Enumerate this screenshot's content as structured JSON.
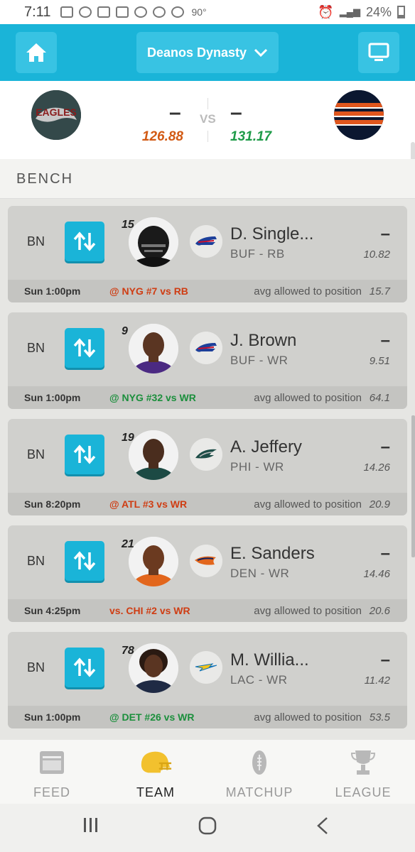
{
  "status": {
    "time": "7:11",
    "temperature": "90°",
    "network": "4G LTE",
    "battery": "24%"
  },
  "header": {
    "league_name": "Deanos Dynasty",
    "home_icon": "home-icon",
    "tv_icon": "monitor-icon",
    "dropdown_icon": "chevron-down-icon"
  },
  "matchup": {
    "home_team_logo": "Philadelphia Eagles logo",
    "away_team_logo": "Chicago striped logo",
    "home_dash": "–",
    "away_dash": "–",
    "vs": "VS",
    "home_score": "126.88",
    "away_score": "131.17"
  },
  "section_title": "BENCH",
  "players": [
    {
      "slot": "BN",
      "number": "15",
      "name": "D. Single...",
      "team_pos": "BUF - RB",
      "projected": "–",
      "points": "10.82",
      "time": "Sun 1:00pm",
      "opponent": "@ NYG #7 vs RB",
      "opponent_color": "red",
      "avg_label": "avg allowed to position",
      "avg_value": "15.7",
      "team_logo": "bills"
    },
    {
      "slot": "BN",
      "number": "9",
      "name": "J. Brown",
      "team_pos": "BUF - WR",
      "projected": "–",
      "points": "9.51",
      "time": "Sun 1:00pm",
      "opponent": "@ NYG #32 vs WR",
      "opponent_color": "green",
      "avg_label": "avg allowed to position",
      "avg_value": "64.1",
      "team_logo": "bills"
    },
    {
      "slot": "BN",
      "number": "19",
      "name": "A. Jeffery",
      "team_pos": "PHI - WR",
      "projected": "–",
      "points": "14.26",
      "time": "Sun 8:20pm",
      "opponent": "@ ATL #3 vs WR",
      "opponent_color": "red",
      "avg_label": "avg allowed to position",
      "avg_value": "20.9",
      "team_logo": "eagles"
    },
    {
      "slot": "BN",
      "number": "21",
      "name": "E. Sanders",
      "team_pos": "DEN - WR",
      "projected": "–",
      "points": "14.46",
      "time": "Sun 4:25pm",
      "opponent": "vs. CHI #2 vs WR",
      "opponent_color": "red",
      "avg_label": "avg allowed to position",
      "avg_value": "20.6",
      "team_logo": "broncos"
    },
    {
      "slot": "BN",
      "number": "78",
      "name": "M. Willia...",
      "team_pos": "LAC - WR",
      "projected": "–",
      "points": "11.42",
      "time": "Sun 1:00pm",
      "opponent": "@ DET #26 vs WR",
      "opponent_color": "green",
      "avg_label": "avg allowed to position",
      "avg_value": "53.5",
      "team_logo": "chargers"
    }
  ],
  "bottom_nav": [
    {
      "label": "FEED",
      "icon": "feed-icon",
      "active": false
    },
    {
      "label": "TEAM",
      "icon": "helmet-icon",
      "active": true
    },
    {
      "label": "MATCHUP",
      "icon": "football-icon",
      "active": false
    },
    {
      "label": "LEAGUE",
      "icon": "trophy-icon",
      "active": false
    }
  ],
  "colors": {
    "accent": "#1ab4d8",
    "score_red": "#d25a14",
    "score_green": "#1e9b48",
    "active_nav": "#f2c12e"
  }
}
